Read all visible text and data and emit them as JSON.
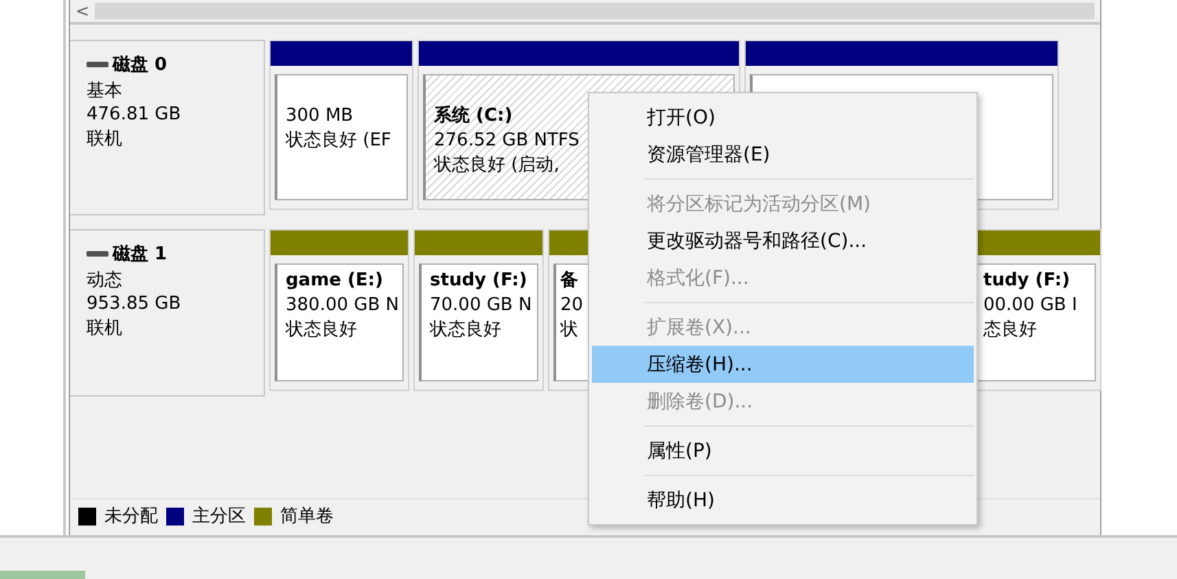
{
  "scrollbar": {
    "arrow": "<"
  },
  "disks": [
    {
      "name": "磁盘 0",
      "type": "基本",
      "size": "476.81 GB",
      "state": "联机",
      "partitions": [
        {
          "color": "#000080",
          "size": "300 MB",
          "status": "状态良好 (EF",
          "selected": false
        },
        {
          "color": "#000080",
          "label": "系统 (C:)",
          "size": "276.52 GB NTFS",
          "status": "状态良好 (启动,",
          "selected": true
        },
        {
          "color": "#000080",
          "selected": false
        }
      ]
    },
    {
      "name": "磁盘 1",
      "type": "动态",
      "size": "953.85 GB",
      "state": "联机",
      "partitions": [
        {
          "color": "#808000",
          "label": "game (E:)",
          "size": "380.00 GB N",
          "status": "状态良好",
          "selected": false
        },
        {
          "color": "#808000",
          "label": "study (F:)",
          "size": "70.00 GB N",
          "status": "状态良好",
          "selected": false
        },
        {
          "color": "#808000",
          "label": "备",
          "size": "20",
          "status": "状",
          "selected": false
        },
        {
          "color": "#808000",
          "label": "tudy (F:)",
          "size": "00.00 GB I",
          "status": "态良好",
          "selected": false
        }
      ]
    }
  ],
  "legend": [
    {
      "label": "未分配",
      "color": "#000000"
    },
    {
      "label": "主分区",
      "color": "#000080"
    },
    {
      "label": "简单卷",
      "color": "#808000"
    }
  ],
  "context_menu": {
    "groups": [
      [
        {
          "label": "打开(O)",
          "disabled": false,
          "selected": false
        },
        {
          "label": "资源管理器(E)",
          "disabled": false,
          "selected": false
        }
      ],
      [
        {
          "label": "将分区标记为活动分区(M)",
          "disabled": true,
          "selected": false
        },
        {
          "label": "更改驱动器号和路径(C)...",
          "disabled": false,
          "selected": false
        },
        {
          "label": "格式化(F)...",
          "disabled": true,
          "selected": false
        }
      ],
      [
        {
          "label": "扩展卷(X)...",
          "disabled": true,
          "selected": false
        },
        {
          "label": "压缩卷(H)...",
          "disabled": false,
          "selected": true
        },
        {
          "label": "删除卷(D)...",
          "disabled": true,
          "selected": false
        }
      ],
      [
        {
          "label": "属性(P)",
          "disabled": false,
          "selected": false
        }
      ],
      [
        {
          "label": "帮助(H)",
          "disabled": false,
          "selected": false
        }
      ]
    ]
  }
}
